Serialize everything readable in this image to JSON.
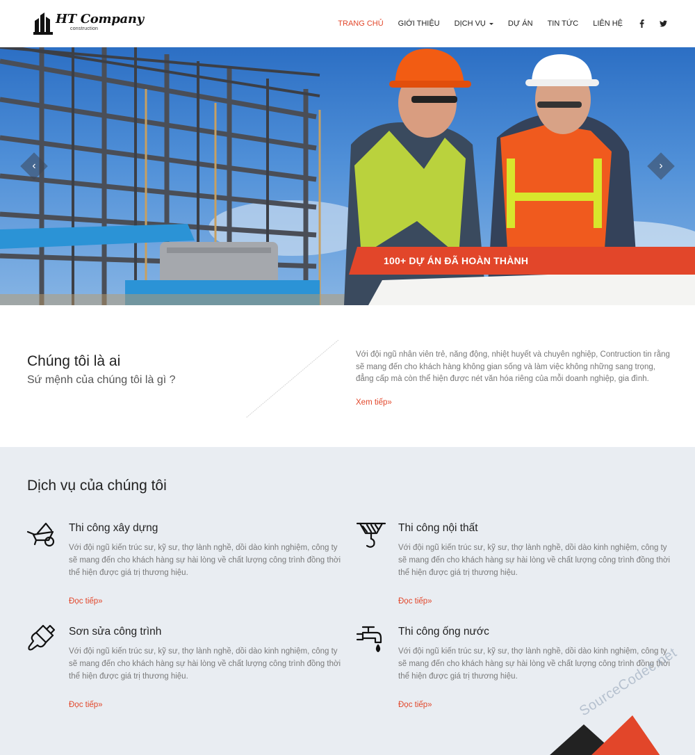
{
  "header": {
    "logo_name": "HT Company",
    "logo_sub": "construction",
    "nav": [
      {
        "label": "TRANG CHỦ",
        "active": true
      },
      {
        "label": "GIỚI THIỆU"
      },
      {
        "label": "DỊCH VỤ",
        "dropdown": true
      },
      {
        "label": "DỰ ÁN"
      },
      {
        "label": "TIN TỨC"
      },
      {
        "label": "LIÊN HỆ"
      }
    ],
    "social": {
      "facebook": "f",
      "twitter": "🐦"
    }
  },
  "hero": {
    "banner_text": "100+ DỰ ÁN ĐÃ HOÀN THÀNH",
    "prev_glyph": "‹",
    "next_glyph": "›"
  },
  "about": {
    "title": "Chúng tôi là ai",
    "subtitle": "Sứ mệnh của chúng tôi là gì ?",
    "text": "Với đội ngũ nhân viên trẻ, năng động, nhiệt huyết và chuyên nghiệp, Contruction tin rằng sẽ mang đến cho khách hàng không gian sống và làm việc không những sang trọng, đẳng cấp mà còn thể hiện được nét văn hóa riêng của mỗi doanh nghiệp, gia đình.",
    "more": "Xem tiếp»"
  },
  "services": {
    "title": "Dịch vụ của chúng tôi",
    "items": [
      {
        "name": "Thi công xây dựng",
        "icon": "wheelbarrow-icon",
        "desc": "Với đội ngũ kiến trúc sư, kỹ sư, thợ lành nghề, dồi dào kinh nghiệm, công ty sẽ mang đến cho khách hàng sự hài lòng về chất lượng công trình đồng thời thể hiện được giá trị thương hiệu.",
        "more": "Đọc tiếp»"
      },
      {
        "name": "Thi công nội thất",
        "icon": "crane-hook-icon",
        "desc": "Với đội ngũ kiến trúc sư, kỹ sư, thợ lành nghề, dồi dào kinh nghiệm, công ty sẽ mang đến cho khách hàng sự hài lòng về chất lượng công trình đồng thời thể hiện được giá trị thương hiệu.",
        "more": "Đọc tiếp»"
      },
      {
        "name": "Sơn sửa công trình",
        "icon": "paint-brush-icon",
        "desc": "Với đội ngũ kiến trúc sư, kỹ sư, thợ lành nghề, dồi dào kinh nghiệm, công ty sẽ mang đến cho khách hàng sự hài lòng về chất lượng công trình đồng thời thể hiện được giá trị thương hiệu.",
        "more": "Đọc tiếp»"
      },
      {
        "name": "Thi công ống nước",
        "icon": "water-tap-icon",
        "desc": "Với đội ngũ kiến trúc sư, kỹ sư, thợ lành nghề, dồi dào kinh nghiệm, công ty sẽ mang đến cho khách hàng sự hài lòng về chất lượng công trình đồng thời thể hiện được giá trị thương hiệu.",
        "more": "Đọc tiếp»"
      }
    ]
  },
  "watermark": "SourceCodec.net",
  "colors": {
    "accent": "#e2462a",
    "services_bg": "#e9edf2"
  }
}
